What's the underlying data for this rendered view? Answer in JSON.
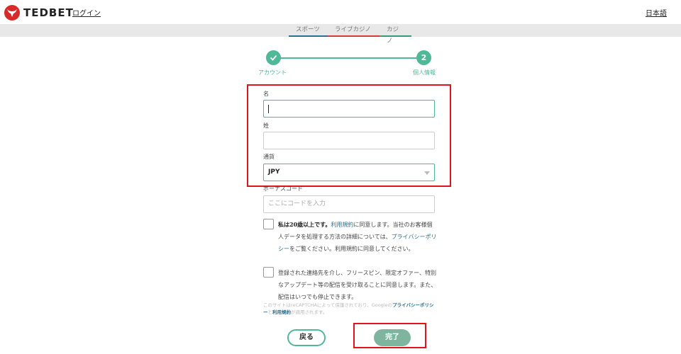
{
  "header": {
    "brand": "TEDBET",
    "login_label": "ログイン",
    "language_label": "日本語"
  },
  "nav": {
    "tabs": [
      {
        "label": "スポーツ",
        "color": "#2c6e8e"
      },
      {
        "label": "ライブカジノ",
        "color": "#d83a3a"
      },
      {
        "label": "カジノ",
        "color": "#3a9a78"
      }
    ]
  },
  "stepper": {
    "steps": [
      {
        "label": "アカウント",
        "state": "done",
        "icon": "check-icon"
      },
      {
        "label": "個人情報",
        "state": "current",
        "number": "2"
      }
    ],
    "accent_color": "#4fb895"
  },
  "form": {
    "first_name": {
      "label": "名",
      "value": ""
    },
    "last_name": {
      "label": "姓",
      "value": ""
    },
    "currency": {
      "label": "通貨",
      "value": "JPY"
    },
    "bonus_code": {
      "label": "ボーナスコード",
      "placeholder": "ここにコードを入力"
    },
    "terms_checkbox": {
      "bold_text": "私は20歳以上です。",
      "link1": "利用規約",
      "text1": "に同意します。当社のお客様個人データを処理する方法の詳細については、",
      "link2": "プライバシーポリシー",
      "text2": "をご覧ください。利用規約に同意してください。",
      "checked": false
    },
    "marketing_checkbox": {
      "text": "登録された連絡先を介し、フリースピン、限定オファー、特別なアップデート等の配信を受け取ることに同意します。また、配信はいつでも停止できます。",
      "checked": false
    },
    "recaptcha": {
      "text1": "このサイトはreCAPTCHAによって保護されており、Googleの",
      "link1": "プライバシーポリシー",
      "text2": "と",
      "link2": "利用規約",
      "text3": "が適用されます。"
    }
  },
  "buttons": {
    "back_label": "戻る",
    "done_label": "完了"
  },
  "colors": {
    "highlight": "#e0141d",
    "brand_red": "#d82a2a",
    "link": "#2c6e8e"
  }
}
